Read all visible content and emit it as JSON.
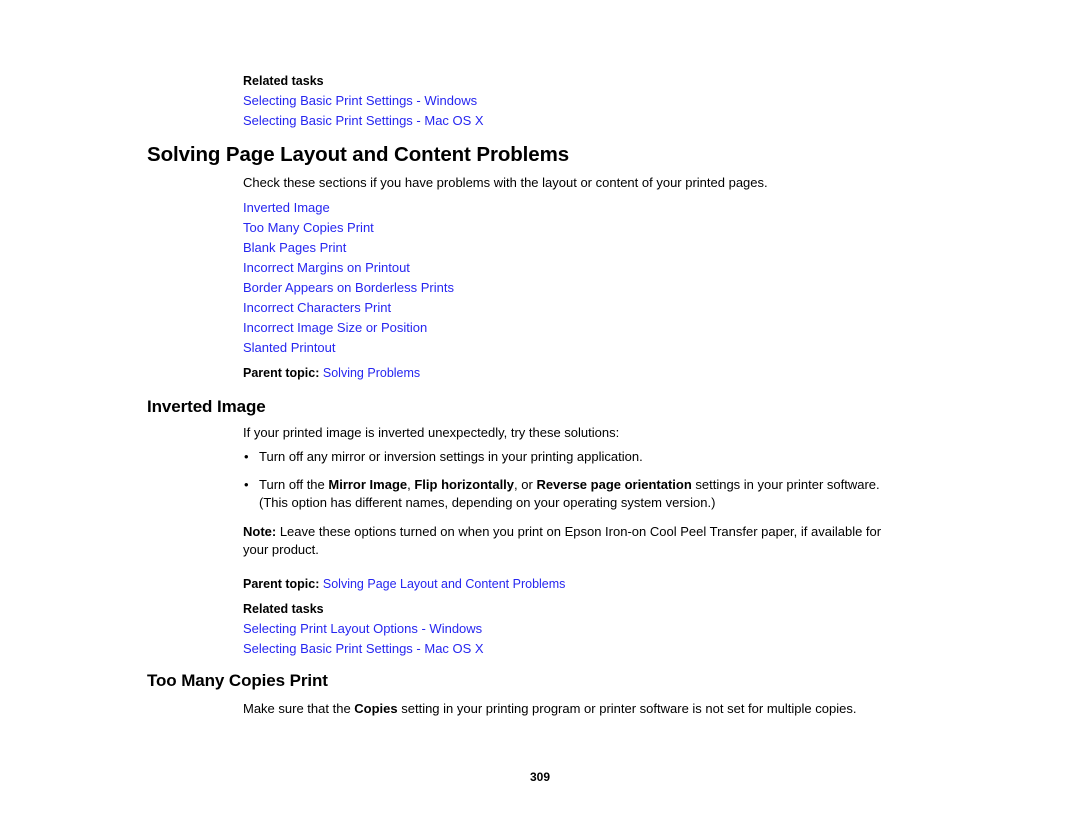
{
  "document": {
    "page_number": "309"
  },
  "related_tasks_top": {
    "label": "Related tasks",
    "links": [
      "Selecting Basic Print Settings - Windows",
      "Selecting Basic Print Settings - Mac OS X"
    ]
  },
  "main_section": {
    "heading": "Solving Page Layout and Content Problems",
    "intro": "Check these sections if you have problems with the layout or content of your printed pages.",
    "topic_links": [
      "Inverted Image",
      "Too Many Copies Print",
      "Blank Pages Print",
      "Incorrect Margins on Printout",
      "Border Appears on Borderless Prints",
      "Incorrect Characters Print",
      "Incorrect Image Size or Position",
      "Slanted Printout"
    ],
    "parent_topic_label": "Parent topic:",
    "parent_topic_link": "Solving Problems"
  },
  "inverted_image": {
    "heading": "Inverted Image",
    "intro": "If your printed image is inverted unexpectedly, try these solutions:",
    "bullets": [
      {
        "parts": [
          {
            "text": "Turn off any mirror or inversion settings in your printing application.",
            "bold": false
          }
        ]
      },
      {
        "parts": [
          {
            "text": "Turn off the ",
            "bold": false
          },
          {
            "text": "Mirror Image",
            "bold": true
          },
          {
            "text": ", ",
            "bold": false
          },
          {
            "text": "Flip horizontally",
            "bold": true
          },
          {
            "text": ", or ",
            "bold": false
          },
          {
            "text": "Reverse page orientation",
            "bold": true
          },
          {
            "text": " settings in your printer software. (This option has different names, depending on your operating system version.)",
            "bold": false
          }
        ]
      }
    ],
    "note_label": "Note:",
    "note_text": " Leave these options turned on when you print on Epson Iron-on Cool Peel Transfer paper, if available for your product.",
    "parent_topic_label": "Parent topic:",
    "parent_topic_link": "Solving Page Layout and Content Problems",
    "related_tasks": {
      "label": "Related tasks",
      "links": [
        "Selecting Print Layout Options - Windows",
        "Selecting Basic Print Settings - Mac OS X"
      ]
    }
  },
  "too_many_copies": {
    "heading": "Too Many Copies Print",
    "body_parts": [
      {
        "text": "Make sure that the ",
        "bold": false
      },
      {
        "text": "Copies",
        "bold": true
      },
      {
        "text": " setting in your printing program or printer software is not set for multiple copies.",
        "bold": false
      }
    ]
  }
}
